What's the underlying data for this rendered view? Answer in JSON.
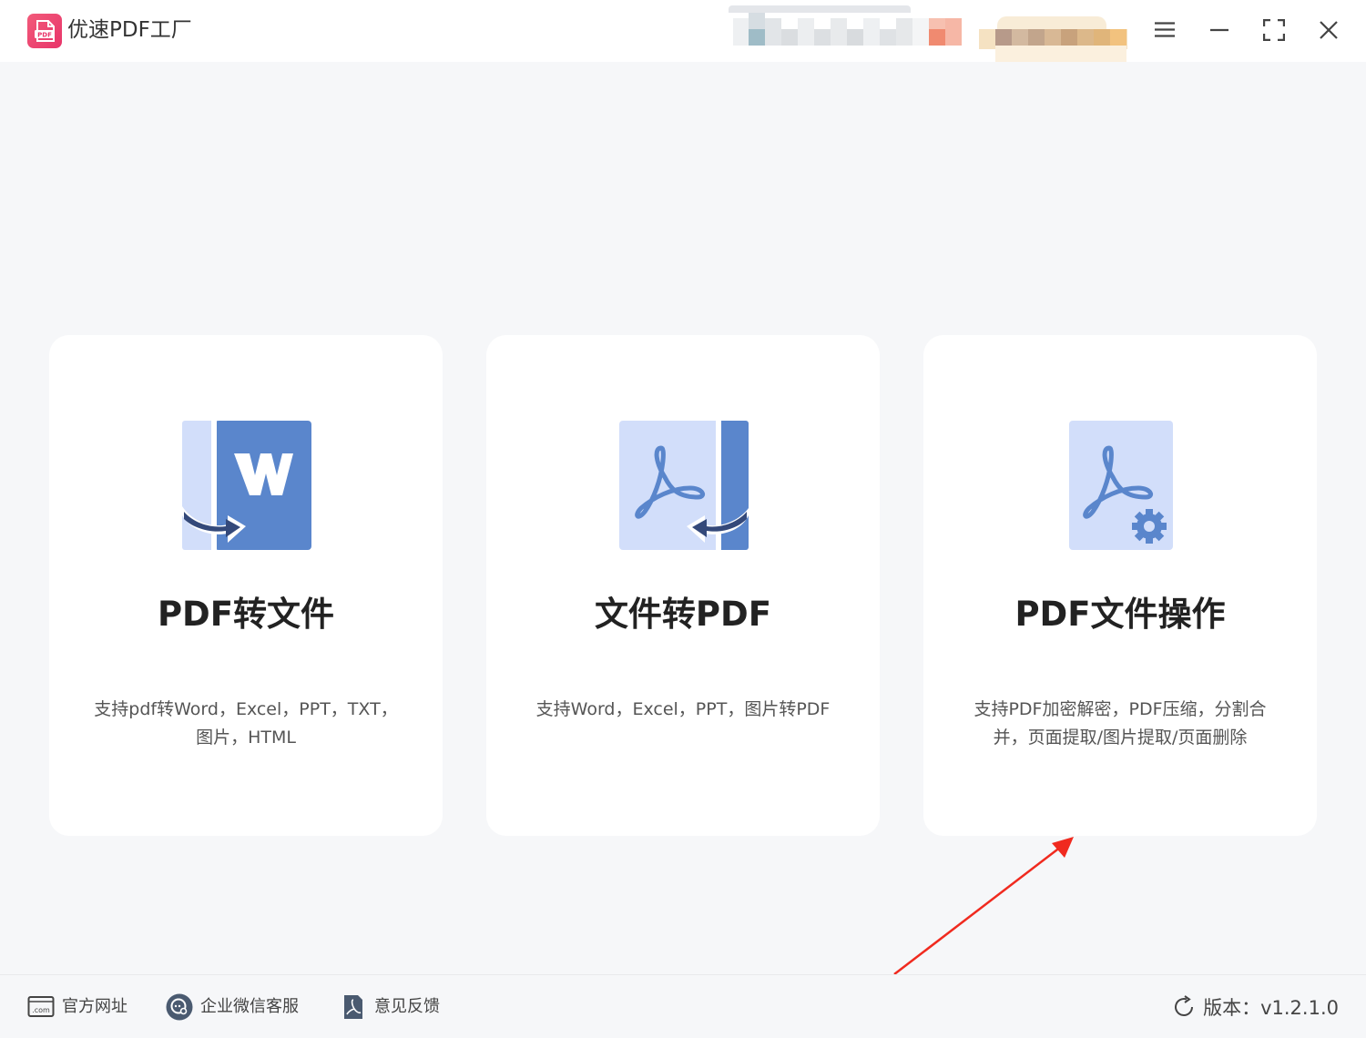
{
  "app": {
    "title": "优速PDF工厂",
    "logo_text": "PDF",
    "brand_color": "#ea4470"
  },
  "window_controls": {
    "menu": "menu-icon",
    "minimize": "minimize-icon",
    "maximize": "maximize-icon",
    "close": "close-icon"
  },
  "cards": [
    {
      "title": "PDF转文件",
      "desc_line1": "支持pdf转Word，Excel，PPT，TXT，",
      "desc_line2": "图片，HTML",
      "icon": "word-document-icon",
      "logo_letter": "W"
    },
    {
      "title": "文件转PDF",
      "desc_line1": "支持Word，Excel，PPT，图片转PDF",
      "desc_line2": "",
      "icon": "pdf-document-icon"
    },
    {
      "title": "PDF文件操作",
      "desc_line1": "支持PDF加密解密，PDF压缩，分割合",
      "desc_line2": "并，页面提取/图片提取/页面删除",
      "icon": "pdf-settings-icon"
    }
  ],
  "footer": {
    "website": "官方网址",
    "website_icon_text": ".com",
    "wechat": "企业微信客服",
    "feedback": "意见反馈",
    "version": "版本：v1.2.1.0"
  },
  "colors": {
    "icon_dark": "#5a86cc",
    "icon_light": "#d2defa",
    "arrow_dark": "#34497a",
    "annotation": "#f02a1f"
  }
}
